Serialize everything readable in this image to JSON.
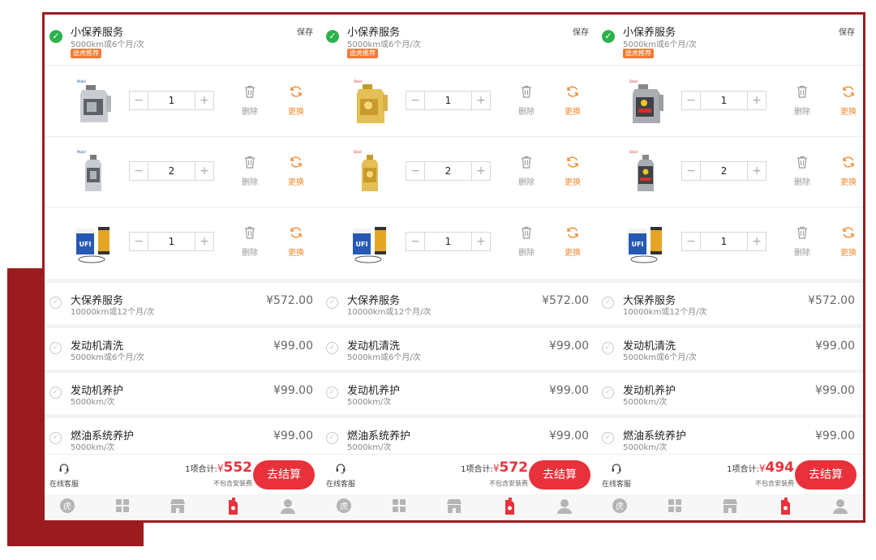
{
  "save_label": "保存",
  "selected_service": {
    "name": "小保养服务",
    "interval": "5000km或6个月/次",
    "badge": "途虎推荐"
  },
  "product_actions": {
    "delete": "删除",
    "replace": "更换"
  },
  "other_services": [
    {
      "name": "大保养服务",
      "interval": "10000km或12个月/次",
      "price": "¥572.00"
    },
    {
      "name": "发动机清洗",
      "interval": "5000km或6个月/次",
      "price": "¥99.00"
    },
    {
      "name": "发动机养护",
      "interval": "5000km/次",
      "price": "¥99.00"
    },
    {
      "name": "燃油系统养护",
      "interval": "5000km/次",
      "price": "¥99.00"
    }
  ],
  "checkout": {
    "customer_service": "在线客服",
    "total_prefix": "1项合计:",
    "currency": "¥",
    "fee_note": "不包含安装费",
    "pay_button": "去结算"
  },
  "tab_icons": [
    "tuhu-logo-icon",
    "grid-icon",
    "shop-icon",
    "oil-can-icon",
    "user-icon"
  ],
  "panels": [
    {
      "products": [
        {
          "image": "oil-bottle-silver-icon",
          "qty": "1"
        },
        {
          "image": "oil-bottle-small-silver-icon",
          "qty": "2"
        },
        {
          "image": "oil-filter-icon",
          "qty": "1"
        }
      ],
      "total": "552"
    },
    {
      "products": [
        {
          "image": "oil-bottle-gold-icon",
          "qty": "1"
        },
        {
          "image": "oil-bottle-small-gold-icon",
          "qty": "2"
        },
        {
          "image": "oil-filter-icon",
          "qty": "1"
        }
      ],
      "total": "572"
    },
    {
      "products": [
        {
          "image": "oil-bottle-grey-icon",
          "qty": "1"
        },
        {
          "image": "oil-bottle-small-grey-icon",
          "qty": "2"
        },
        {
          "image": "oil-filter-icon",
          "qty": "1"
        }
      ],
      "total": "494"
    }
  ],
  "colors": {
    "accent_red": "#e8313a",
    "frame_red": "#9b1c1f",
    "check_green": "#2bb24c",
    "replace_orange": "#f08a2f",
    "badge_orange": "#f47b36"
  }
}
